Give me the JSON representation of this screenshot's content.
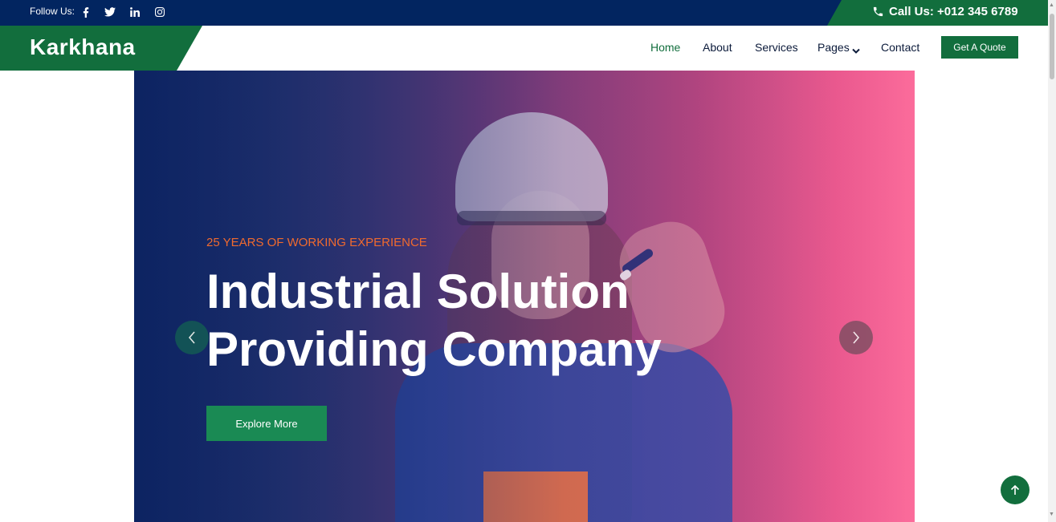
{
  "topbar": {
    "follow_label": "Follow Us:",
    "socials": [
      "facebook-icon",
      "twitter-icon",
      "linkedin-icon",
      "instagram-icon"
    ],
    "call_label": "Call Us: +012 345 6789"
  },
  "brand": {
    "name": "Karkhana"
  },
  "nav": {
    "items": [
      "Home",
      "About",
      "Services",
      "Pages",
      "Contact"
    ],
    "active": "Home",
    "quote_button": "Get A Quote"
  },
  "hero": {
    "eyebrow": "25 YEARS OF WORKING EXPERIENCE",
    "title_line1": "Industrial Solution",
    "title_line2": "Providing Company",
    "cta": "Explore More"
  },
  "colors": {
    "primary_green": "#126e3d",
    "navy": "#022560",
    "accent_orange": "#f06a2e",
    "pink": "#fb6e9c"
  },
  "icons": {
    "phone": "phone-icon",
    "prev": "chevron-left-icon",
    "next": "chevron-right-icon",
    "back_to_top": "arrow-up-icon",
    "dropdown": "chevron-down-icon"
  }
}
